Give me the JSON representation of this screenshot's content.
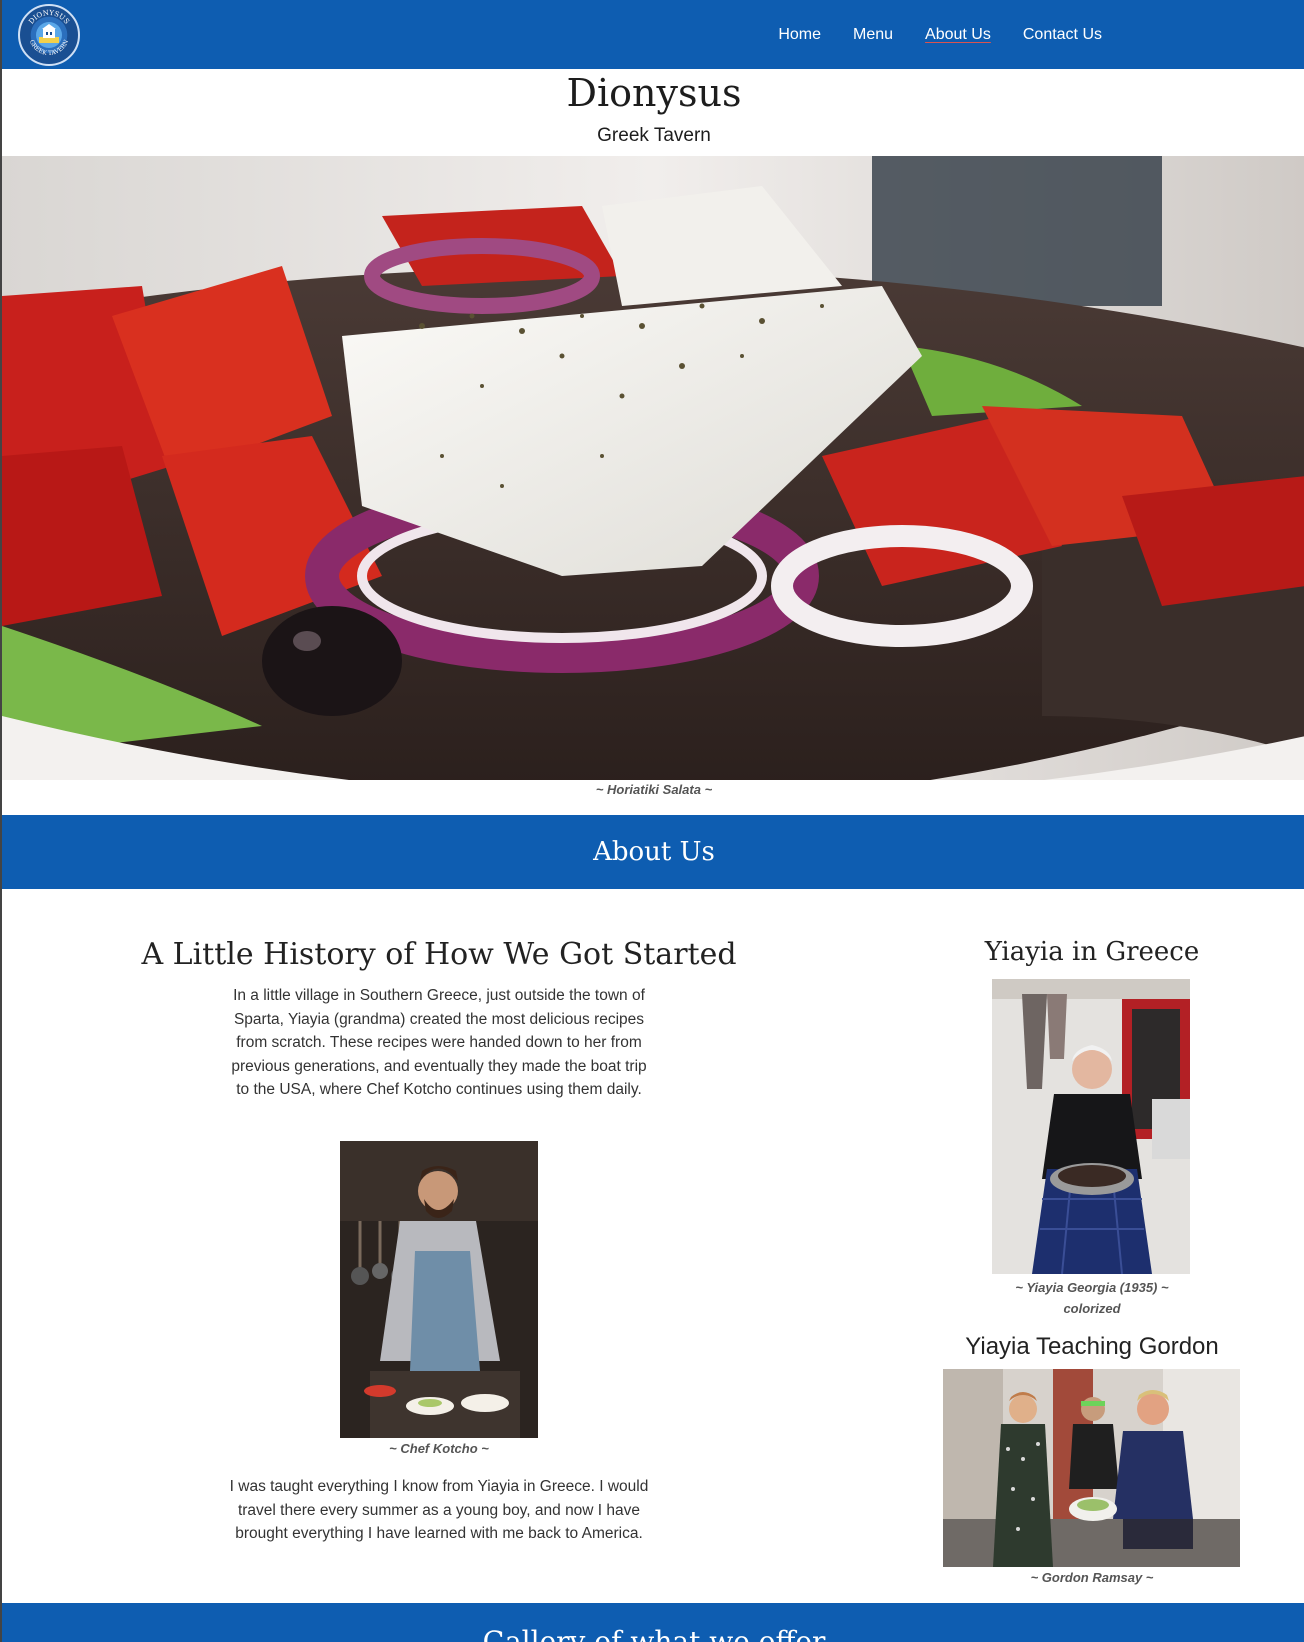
{
  "nav": {
    "logo_text_top": "DIONYSUS",
    "logo_text_bottom": "GREEK TAVERN",
    "links": [
      "Home",
      "Menu",
      "About Us",
      "Contact Us"
    ],
    "active": "About Us"
  },
  "header": {
    "title": "Dionysus",
    "subtitle": "Greek Tavern"
  },
  "hero": {
    "caption": "~ Horiatiki Salata ~"
  },
  "about": {
    "section_title": "About Us",
    "history_title": "A Little History of How We Got Started",
    "history_paragraph": "In a little village in Southern Greece, just outside the town of Sparta, Yiayia (grandma) created the most delicious recipes from scratch. These recipes were handed down to her from previous generations, and eventually they made the boat trip to the USA, where Chef Kotcho continues using them daily.",
    "chef_caption": "~ Chef Kotcho ~",
    "learned_paragraph": "I was taught everything I know from Yiayia in Greece. I would travel there every summer as a young boy, and now I have brought everything I have learned with me back to America.",
    "yiayia_title": "Yiayia in Greece",
    "yiayia_caption_line1": "~ Yiayia Georgia (1935) ~",
    "yiayia_caption_line2": "colorized",
    "teaching_title": "Yiayia Teaching Gordon",
    "teaching_caption": "~ Gordon Ramsay ~"
  },
  "gallery": {
    "title": "Gallery of what we offer"
  },
  "colors": {
    "brand_blue": "#0e5db1",
    "active_underline": "#d9534f"
  }
}
